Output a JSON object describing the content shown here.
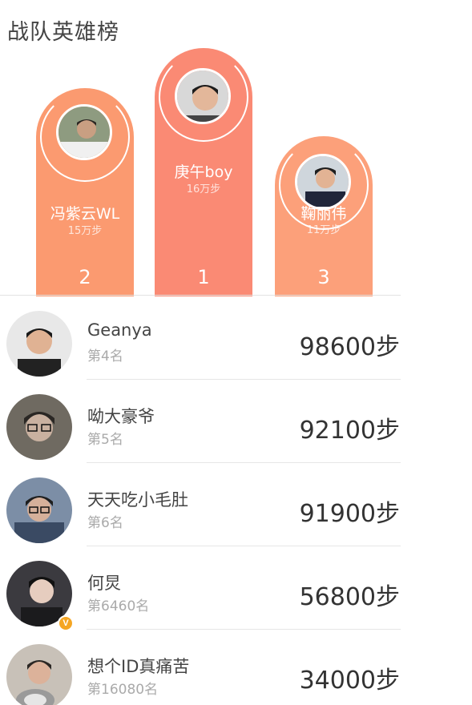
{
  "title": "战队英雄榜",
  "colors": {
    "pillar_1": "#fa8a74",
    "pillar_2": "#fb9a70",
    "pillar_3": "#fca07a",
    "badge": "#f5a623"
  },
  "podium": [
    {
      "position": 2,
      "name": "冯紫云WL",
      "steps": "15万步",
      "rank_label": "2"
    },
    {
      "position": 1,
      "name": "庚午boy",
      "steps": "16万步",
      "rank_label": "1"
    },
    {
      "position": 3,
      "name": "鞠丽伟",
      "steps": "11万步",
      "rank_label": "3"
    }
  ],
  "list": [
    {
      "name": "Geanya",
      "rank": "第4名",
      "steps": "98600步"
    },
    {
      "name": "呦大豪爷",
      "rank": "第5名",
      "steps": "92100步"
    },
    {
      "name": "天天吃小毛肚",
      "rank": "第6名",
      "steps": "91900步"
    },
    {
      "name": "何炅",
      "rank": "第6460名",
      "steps": "56800步",
      "verified": "V"
    },
    {
      "name": "想个ID真痛苦",
      "rank": "第16080名",
      "steps": "34000步"
    }
  ]
}
